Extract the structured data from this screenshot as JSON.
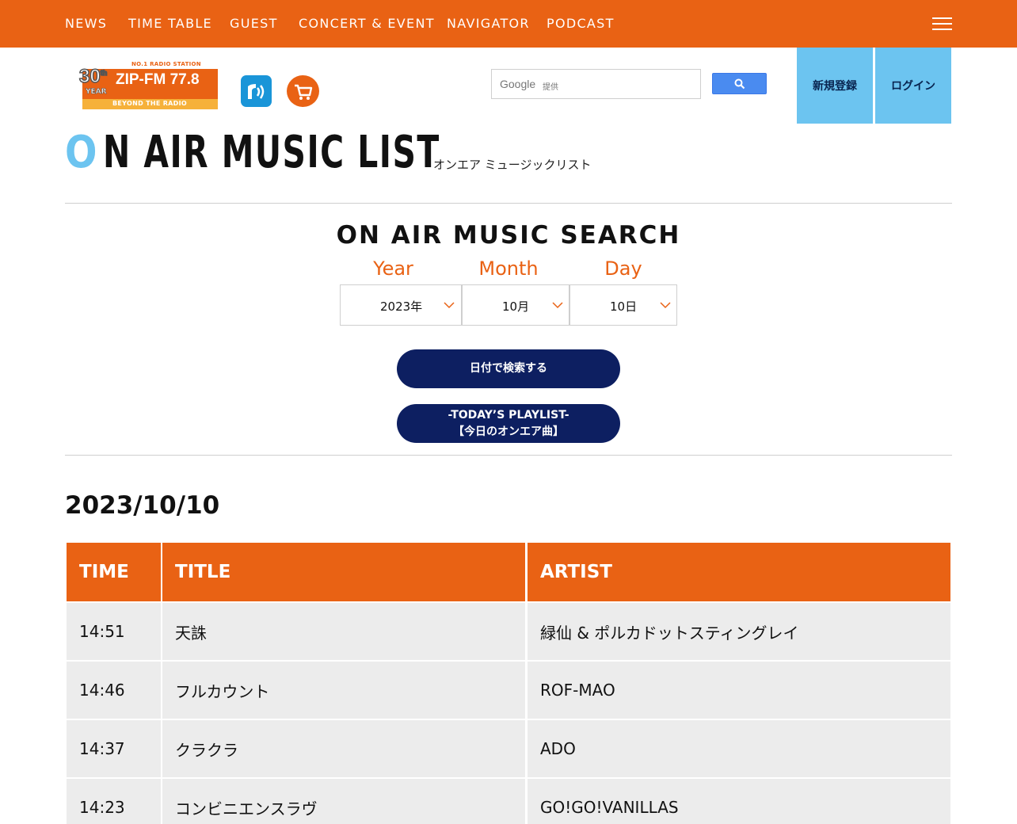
{
  "nav": {
    "items": [
      "NEWS",
      "TIME TABLE",
      "GUEST",
      "CONCERT & EVENT",
      "NAVIGATOR",
      "PODCAST"
    ]
  },
  "logo": {
    "badge": "NO.1 RADIO STATION",
    "years": "30",
    "years_suffix": "th",
    "year_word": "YEAR",
    "name": "ZIP-FM 77.8",
    "tagline": "BEYOND THE RADIO"
  },
  "search": {
    "google_label": "Google",
    "google_sub": "提供"
  },
  "auth": {
    "register": "新規登録",
    "login": "ログイン"
  },
  "page": {
    "title_first": "O",
    "title_rest": "N AIR MUSIC LIST",
    "subtitle": "オンエア ミュージックリスト"
  },
  "music_search": {
    "heading": "ON AIR MUSIC SEARCH",
    "year_label": "Year",
    "month_label": "Month",
    "day_label": "Day",
    "year_value": "2023年",
    "month_value": "10月",
    "day_value": "10日",
    "search_button": "日付で検索する",
    "today_line1": "-TODAY’S PLAYLIST-",
    "today_line2": "【今日のオンエア曲】"
  },
  "playlist": {
    "date": "2023/10/10",
    "columns": [
      "TIME",
      "TITLE",
      "ARTIST"
    ],
    "rows": [
      {
        "time": "14:51",
        "title": "天誅",
        "artist": "緑仙 & ポルカドットスティングレイ"
      },
      {
        "time": "14:46",
        "title": "フルカウント",
        "artist": "ROF-MAO"
      },
      {
        "time": "14:37",
        "title": "クラクラ",
        "artist": "ADO"
      },
      {
        "time": "14:23",
        "title": "コンビニエンスラヴ",
        "artist": "GO!GO!VANILLAS"
      }
    ]
  },
  "colors": {
    "brand_orange": "#e96214",
    "accent_blue": "#6cc4f0",
    "navy": "#0d1f61"
  }
}
